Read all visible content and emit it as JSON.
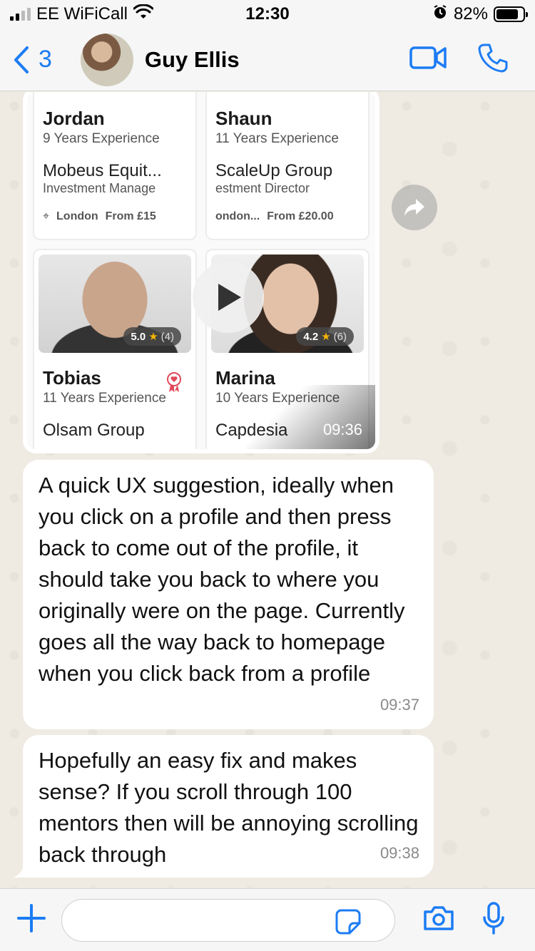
{
  "status_bar": {
    "carrier": "EE WiFiCall",
    "time": "12:30",
    "battery_percent": "82%",
    "battery_level": 0.82
  },
  "header": {
    "back_count": "3",
    "contact_name": "Guy Ellis",
    "icons": [
      "video-call-icon",
      "phone-icon"
    ]
  },
  "video_message": {
    "time": "09:36",
    "cards": [
      {
        "name": "Jordan",
        "experience": "9 Years Experience",
        "company": "Mobeus Equit...",
        "role": "Investment Manage",
        "location": "London",
        "price": "From £15"
      },
      {
        "name": "Shaun",
        "experience": "11 Years Experience",
        "company": "ScaleUp Group",
        "role": "estment Director",
        "location": "ondon...",
        "price": "From £20.00"
      },
      {
        "name": "Tobias",
        "experience": "11 Years Experience",
        "company": "Olsam Group",
        "rating": "5.0",
        "rating_count": "(4)"
      },
      {
        "name": "Marina",
        "experience": "10 Years Experience",
        "company": "Capdesia",
        "rating": "4.2",
        "rating_count": "(6)"
      }
    ]
  },
  "messages": [
    {
      "text": "A quick UX suggestion, ideally when you click on a profile and then press back to come out of the profile, it should take you back to where you originally were on the page. Currently goes all the way back to homepage when you click back from a profile",
      "time": "09:37"
    },
    {
      "text": "Hopefully an easy fix and makes sense? If you scroll through 100 mentors then will be annoying scrolling back through",
      "time": "09:38"
    }
  ],
  "input": {
    "value": "",
    "placeholder": ""
  },
  "colors": {
    "accent": "#1c7cf4",
    "chat_background": "#efeae2",
    "bubble": "#ffffff"
  }
}
